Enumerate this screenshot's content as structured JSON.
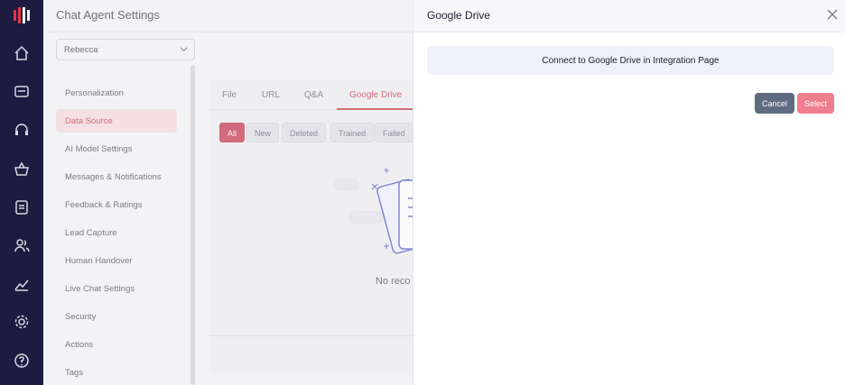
{
  "header": {
    "title": "Chat Agent Settings"
  },
  "agent_select": {
    "value": "Rebecca"
  },
  "sidebar": {
    "icons": [
      "logo-icon",
      "home-icon",
      "chat-icon",
      "headset-icon",
      "basket-icon",
      "notes-icon",
      "users-icon",
      "analytics-icon",
      "settings-icon",
      "help-icon"
    ],
    "items": [
      {
        "label": "Personalization"
      },
      {
        "label": "Data Source"
      },
      {
        "label": "AI Model Settings"
      },
      {
        "label": "Messages & Notifications"
      },
      {
        "label": "Feedback & Ratings"
      },
      {
        "label": "Lead Capture"
      },
      {
        "label": "Human Handover"
      },
      {
        "label": "Live Chat Settings"
      },
      {
        "label": "Security"
      },
      {
        "label": "Actions"
      },
      {
        "label": "Tags"
      }
    ],
    "active_item": "Data Source"
  },
  "tabs": [
    {
      "label": "File"
    },
    {
      "label": "URL"
    },
    {
      "label": "Q&A"
    },
    {
      "label": "Google Drive"
    }
  ],
  "active_tab": "Google Drive",
  "filters": [
    {
      "label": "All"
    },
    {
      "label": "New"
    },
    {
      "label": "Deleted"
    },
    {
      "label": "Trained"
    },
    {
      "label": "Failed"
    }
  ],
  "empty_state": {
    "text": "No reco"
  },
  "drawer": {
    "title": "Google Drive",
    "notice": "Connect to Google Drive in Integration Page",
    "cancel_label": "Cancel",
    "select_label": "Select"
  },
  "colors": {
    "accent": "#c2243c",
    "rail": "#1d1b3f",
    "cancel": "#5f6b80",
    "select": "#ef7f8c"
  }
}
